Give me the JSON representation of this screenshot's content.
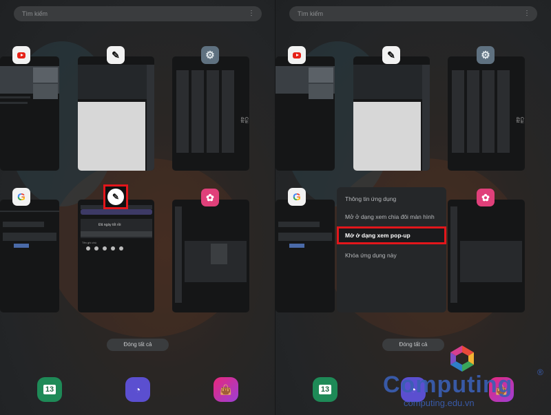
{
  "panels": {
    "left": {
      "search_placeholder": "Tìm kiếm",
      "close_all_label": "Đóng tất cả",
      "recent_app_settings_text": "Cài đặt",
      "note_app_texts": {
        "greeting": "Đã ngày tốt rồi",
        "row_text": "Tên ghi chú"
      }
    },
    "right": {
      "search_placeholder": "Tìm kiếm",
      "close_all_label": "Đóng tất cả",
      "recent_app_settings_text": "Cài đặt",
      "context_menu": {
        "items": [
          "Thông tin ứng dụng",
          "Mở ở dạng xem chia đôi màn hình",
          "Mở ở dạng xem pop-up",
          "Khóa ứng dụng này"
        ],
        "highlighted_index": 2
      }
    }
  },
  "dock": {
    "calendar_day": "13"
  },
  "watermark": {
    "brand": "Computing",
    "url": "computing.edu.vn",
    "reg": "®"
  },
  "colors": {
    "highlight_red": "#e3161b",
    "background": "#202124",
    "watermark_blue": "#3a5fb4"
  }
}
